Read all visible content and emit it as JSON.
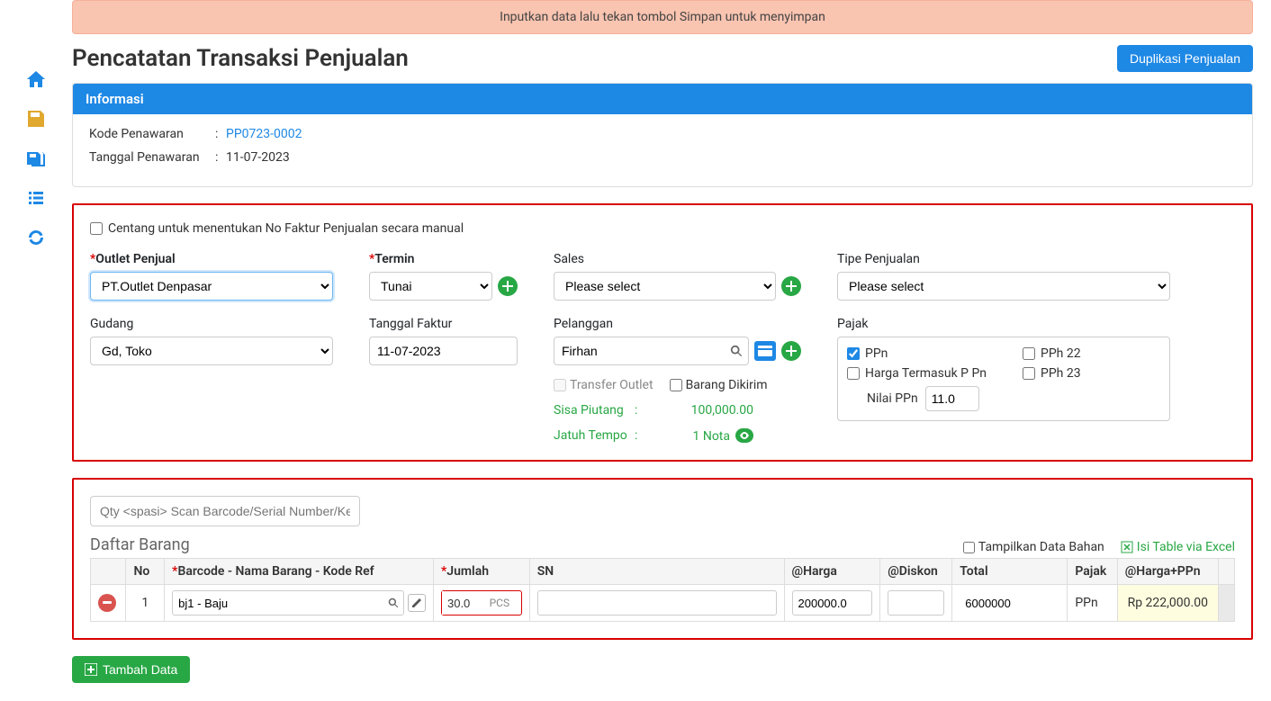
{
  "alert": "Inputkan data lalu tekan tombol Simpan untuk menyimpan",
  "page_title": "Pencatatan Transaksi Penjualan",
  "duplikasi_btn": "Duplikasi Penjualan",
  "info_panel": {
    "title": "Informasi",
    "kode_label": "Kode Penawaran",
    "kode_value": "PP0723-0002",
    "tanggal_label": "Tanggal Penawaran",
    "tanggal_value": "11-07-2023"
  },
  "manual_check_label": "Centang untuk menentukan No Faktur Penjualan secara manual",
  "form": {
    "outlet_label": "Outlet Penjual",
    "outlet_value": "PT.Outlet Denpasar",
    "termin_label": "Termin",
    "termin_value": "Tunai",
    "sales_label": "Sales",
    "sales_value": "Please select",
    "tipe_label": "Tipe Penjualan",
    "tipe_value": "Please select",
    "gudang_label": "Gudang",
    "gudang_value": "Gd, Toko",
    "tgl_faktur_label": "Tanggal Faktur",
    "tgl_faktur_value": "11-07-2023",
    "pelanggan_label": "Pelanggan",
    "pelanggan_value": "Firhan",
    "transfer_outlet": "Transfer Outlet",
    "barang_dikirim": "Barang Dikirim",
    "sisa_piutang_label": "Sisa Piutang",
    "sisa_piutang_value": "100,000.00",
    "jatuh_tempo_label": "Jatuh Tempo",
    "jatuh_tempo_value": "1 Nota",
    "pajak_label": "Pajak",
    "ppn": "PPn",
    "harga_termasuk": "Harga Termasuk P Pn",
    "nilai_ppn_label": "Nilai PPn",
    "nilai_ppn_value": "11.0",
    "pph22": "PPh 22",
    "pph23": "PPh 23"
  },
  "scan_placeholder": "Qty <spasi> Scan Barcode/Serial Number/Ketik Na",
  "daftar_title": "Daftar Barang",
  "tampilkan_bahan": "Tampilkan Data Bahan",
  "isi_excel": "Isi Table via Excel",
  "table": {
    "headers": {
      "no": "No",
      "barcode": "Barcode - Nama Barang - Kode Ref",
      "jumlah": "Jumlah",
      "sn": "SN",
      "harga": "@Harga",
      "diskon": "@Diskon",
      "total": "Total",
      "pajak": "Pajak",
      "hppn": "@Harga+PPn"
    },
    "rows": [
      {
        "no": "1",
        "barcode": "bj1 - Baju",
        "jumlah": "30.0",
        "unit": "PCS",
        "sn": "",
        "harga": "200000.0",
        "diskon": "",
        "total": "6000000",
        "pajak": "PPn",
        "hppn": "Rp 222,000.00"
      }
    ]
  },
  "tambah_btn": "Tambah Data"
}
